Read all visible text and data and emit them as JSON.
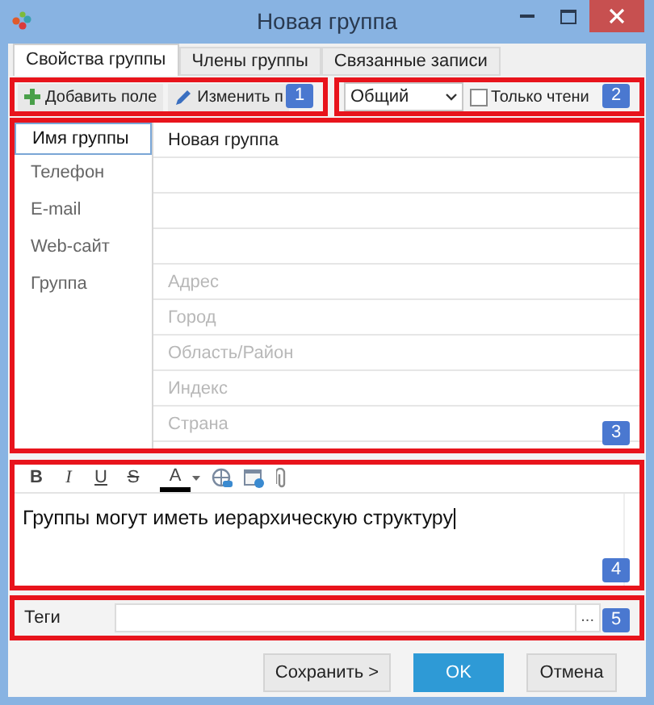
{
  "window": {
    "title": "Новая группа"
  },
  "tabs": [
    {
      "label": "Свойства группы",
      "selected": true
    },
    {
      "label": "Члены группы",
      "selected": false
    },
    {
      "label": "Связанные записи",
      "selected": false
    }
  ],
  "toolbar": {
    "buttons": [
      {
        "label": "Добавить поле",
        "kind": "add"
      },
      {
        "label": "Изменить п",
        "kind": "edit"
      }
    ],
    "dropdown": {
      "value": "Общий"
    },
    "checkbox": {
      "label": "Только чтени",
      "checked": false
    }
  },
  "fields": {
    "labels": [
      {
        "label": "Имя группы",
        "selected": true
      },
      {
        "label": "Телефон",
        "selected": false
      },
      {
        "label": "E-mail",
        "selected": false
      },
      {
        "label": "Web-сайт",
        "selected": false
      },
      {
        "label": "Группа",
        "selected": false
      }
    ],
    "values": [
      {
        "value": "Новая группа"
      }
    ],
    "address": [
      {
        "placeholder": "Адрес"
      },
      {
        "placeholder": "Город"
      },
      {
        "placeholder": "Область/Район"
      },
      {
        "placeholder": "Индекс"
      },
      {
        "placeholder": "Страна"
      }
    ]
  },
  "editor": {
    "format_buttons": [
      {
        "label": "B",
        "kind": "bold"
      },
      {
        "label": "I",
        "kind": "italic"
      },
      {
        "label": "U",
        "kind": "underline"
      },
      {
        "label": "S",
        "kind": "strike"
      },
      {
        "label": "A",
        "kind": "color"
      }
    ],
    "text": "Группы могут иметь иерархическую структуру"
  },
  "tags": {
    "label": "Теги",
    "browse": "..."
  },
  "buttons": [
    {
      "label": "Сохранить >",
      "kind": "normal"
    },
    {
      "label": "OK",
      "kind": "primary"
    },
    {
      "label": "Отмена",
      "kind": "normal"
    }
  ],
  "callouts": [
    "1",
    "2",
    "3",
    "4",
    "5"
  ]
}
